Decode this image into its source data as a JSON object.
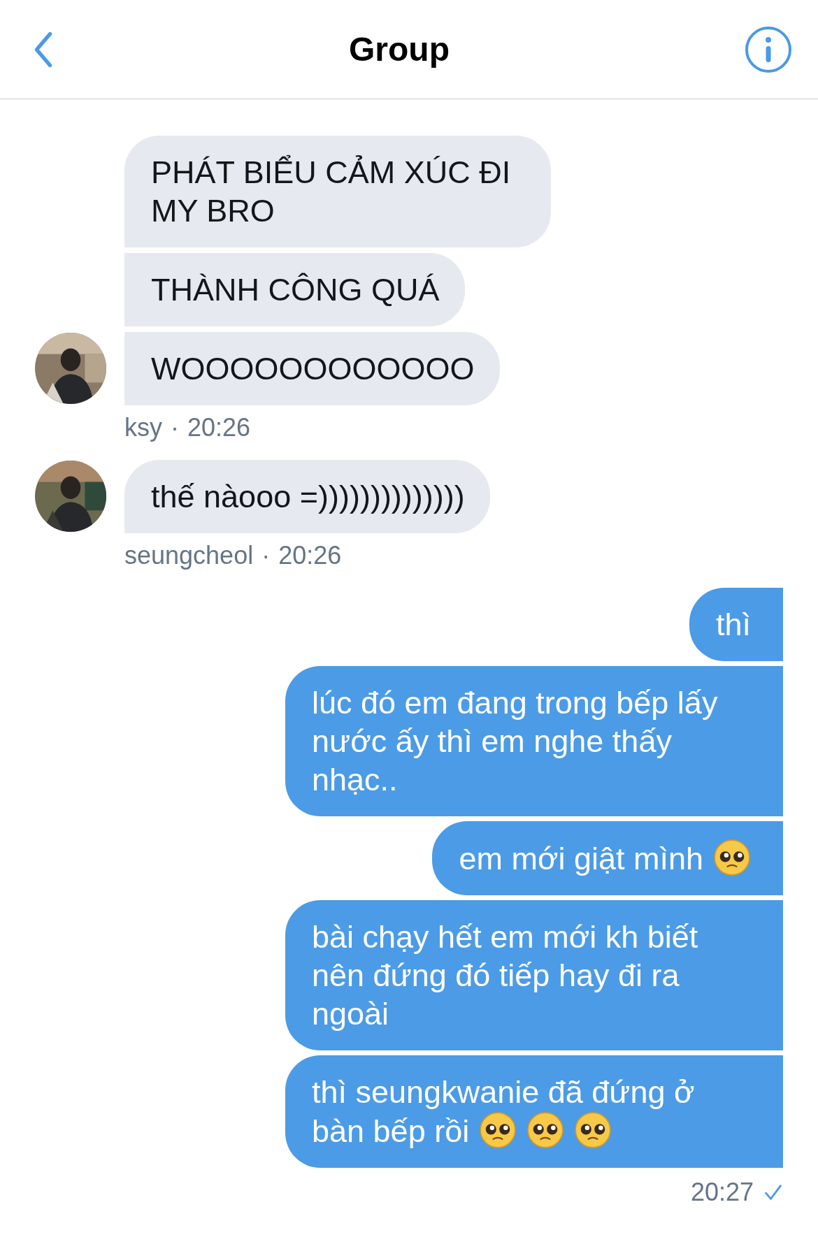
{
  "header": {
    "title": "Group"
  },
  "groups": [
    {
      "kind": "incoming",
      "sender": "ksy",
      "separator": "·",
      "time": "20:26",
      "messages": [
        {
          "text": "PHÁT BIỂU CẢM XÚC ĐI MY BRO"
        },
        {
          "text": "THÀNH CÔNG QUÁ"
        },
        {
          "text": "WOOOOOOOOOOOO"
        }
      ]
    },
    {
      "kind": "incoming",
      "sender": "seungcheol",
      "separator": "·",
      "time": "20:26",
      "messages": [
        {
          "text": "thế nàooo =))))))))))))))"
        }
      ]
    },
    {
      "kind": "outgoing",
      "time": "20:27",
      "read": true,
      "messages": [
        {
          "text": "thì"
        },
        {
          "text": "lúc đó em đang trong bếp lấy nước ấy thì em nghe thấy nhạc.."
        },
        {
          "text": "em mới giật mình",
          "emojis": [
            {
              "kind": "pleading"
            }
          ]
        },
        {
          "text": "bài chạy hết em mới kh biết nên đứng đó tiếp hay đi ra ngoài"
        },
        {
          "text": "thì seungkwanie đã đứng ở bàn bếp rồi",
          "emojis": [
            {
              "kind": "pleading"
            },
            {
              "kind": "pleading"
            },
            {
              "kind": "pleading"
            }
          ]
        }
      ]
    }
  ]
}
